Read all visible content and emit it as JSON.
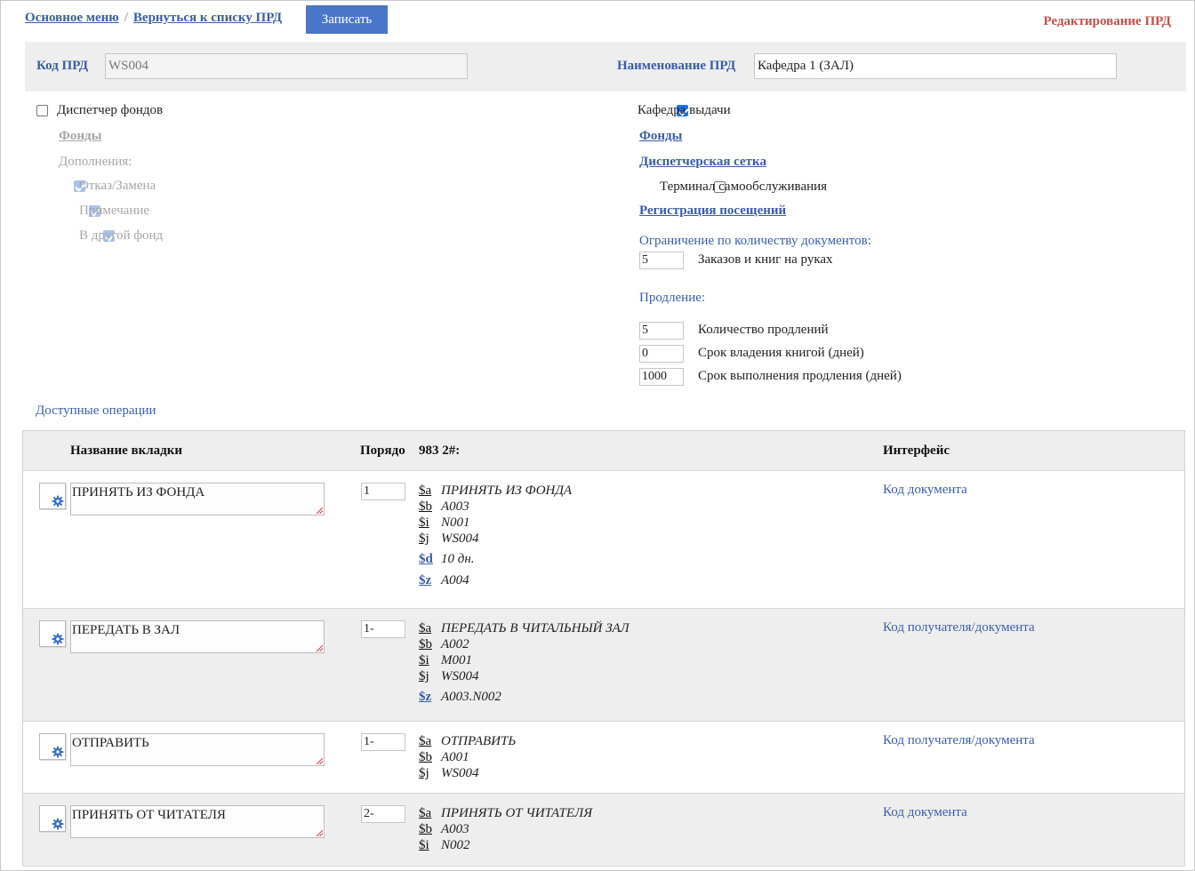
{
  "nav": {
    "main_menu": "Основное меню",
    "separator": "/",
    "back": "Вернуться к списку ПРД",
    "save": "Записать",
    "page_title": "Редактирование ПРД"
  },
  "form": {
    "code_label": "Код ПРД",
    "code_value": "WS004",
    "name_label": "Наименование ПРД",
    "name_value": "Кафедра 1 (ЗАЛ)"
  },
  "left": {
    "dispatcher": "Диспетчер фондов",
    "funds": "Фонды",
    "additions": "Дополнения:",
    "opt1": "Отказ/Замена",
    "opt2": "Примечание",
    "opt3": "В другой фонд"
  },
  "right": {
    "issue_desk": "Кафедра выдачи",
    "funds": "Фонды",
    "grid": "Диспетчерская сетка",
    "terminal": "Терминал самообслуживания",
    "visits": "Регистрация посещений",
    "limit_label": "Ограничение по количеству документов:",
    "limit_value": "5",
    "limit_desc": "Заказов и книг на руках",
    "renew_label": "Продление:",
    "renew_count_value": "5",
    "renew_count_desc": "Количество продлений",
    "hold_value": "0",
    "hold_desc": "Срок владения книгой (дней)",
    "renew_term_value": "1000",
    "renew_term_desc": "Срок выполнения продления (дней)"
  },
  "ops": {
    "title": "Доступные операции",
    "headers": {
      "tab": "Название вкладки",
      "order": "Порядо",
      "field": "983 2#:",
      "iface": "Интерфейс"
    },
    "rows": [
      {
        "name": "ПРИНЯТЬ ИЗ ФОНДА",
        "order": "1",
        "iface": "Код документа",
        "subfields": [
          {
            "code": "$a",
            "value": "ПРИНЯТЬ ИЗ ФОНДА"
          },
          {
            "code": "$b",
            "value": "А003"
          },
          {
            "code": "$i",
            "value": "N001"
          },
          {
            "code": "$j",
            "value": "WS004"
          },
          {
            "code": "$d",
            "value": "10 дн."
          },
          {
            "code": "$z",
            "value": "А004"
          }
        ]
      },
      {
        "name": "ПЕРЕДАТЬ В ЗАЛ",
        "order": "1-",
        "iface": "Код получателя/документа",
        "subfields": [
          {
            "code": "$a",
            "value": "ПЕРЕДАТЬ В ЧИТАЛЬНЫЙ ЗАЛ"
          },
          {
            "code": "$b",
            "value": "А002"
          },
          {
            "code": "$i",
            "value": "М001"
          },
          {
            "code": "$j",
            "value": "WS004"
          },
          {
            "code": "$z",
            "value": "А003.N002"
          }
        ]
      },
      {
        "name": "ОТПРАВИТЬ",
        "order": "1-",
        "iface": "Код получателя/документа",
        "subfields": [
          {
            "code": "$a",
            "value": "ОТПРАВИТЬ"
          },
          {
            "code": "$b",
            "value": "А001"
          },
          {
            "code": "$j",
            "value": "WS004"
          }
        ]
      },
      {
        "name": "ПРИНЯТЬ ОТ ЧИТАТЕЛЯ",
        "order": "2-",
        "iface": "Код документа",
        "subfields": [
          {
            "code": "$a",
            "value": "ПРИНЯТЬ ОТ ЧИТАТЕЛЯ"
          },
          {
            "code": "$b",
            "value": "А003"
          },
          {
            "code": "$i",
            "value": "N002"
          }
        ]
      }
    ]
  }
}
